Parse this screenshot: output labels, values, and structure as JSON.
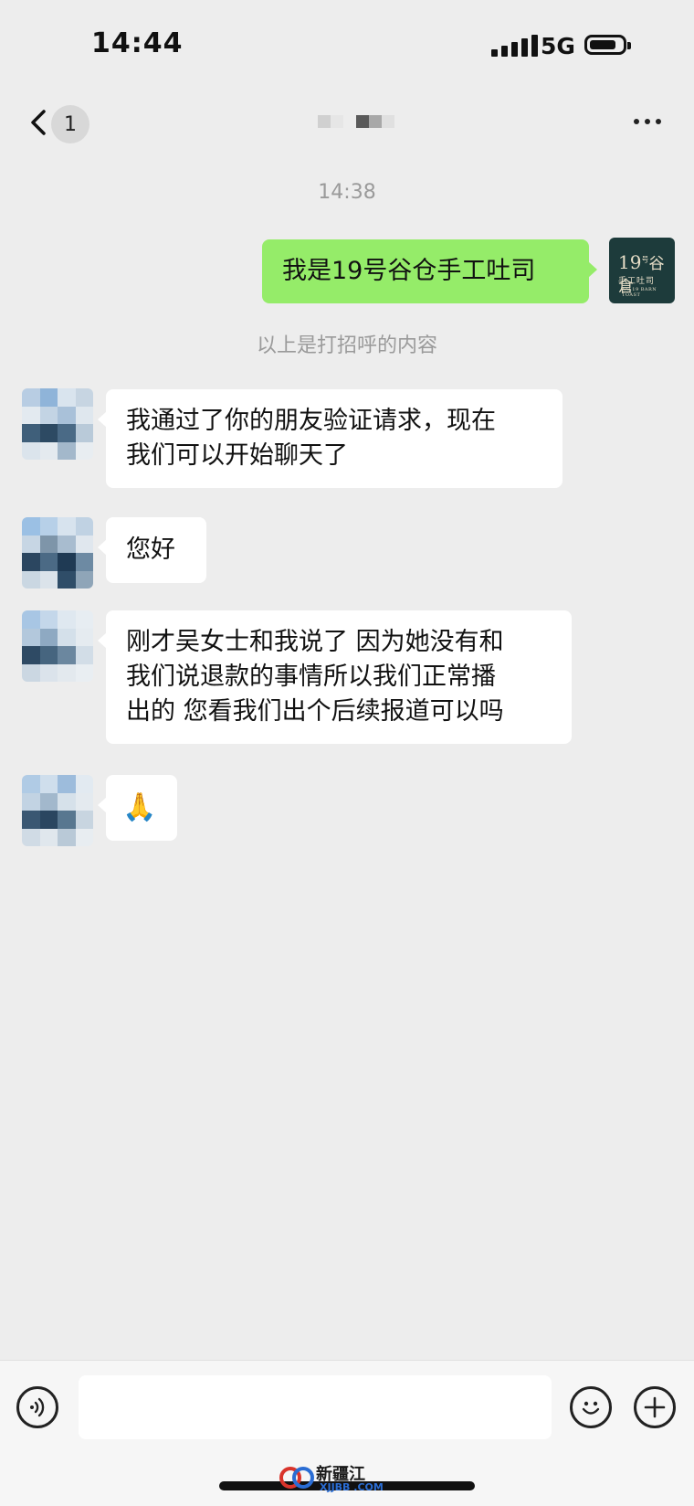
{
  "status_bar": {
    "time": "14:44",
    "network": "5G"
  },
  "nav": {
    "unread_count": "1"
  },
  "chat": {
    "timestamp": "14:38",
    "system_note": "以上是打招呼的内容",
    "messages": [
      {
        "side": "out",
        "text": "我是19号谷仓手工吐司"
      },
      {
        "side": "in",
        "lines": [
          "我通过了你的朋友验证请求，现在",
          "我们可以开始聊天了"
        ]
      },
      {
        "side": "in",
        "text": "您好"
      },
      {
        "side": "in",
        "lines": [
          "刚才吴女士和我说了 因为她没有和",
          "我们说退款的事情所以我们正常播",
          "出的 您看我们出个后续报道可以吗"
        ]
      },
      {
        "side": "in",
        "text": "🙏"
      }
    ]
  },
  "self_avatar": {
    "line1": "19",
    "line1_sup": "号",
    "line2": "谷倉",
    "line3": "手工吐司",
    "line4": "NO.19 BARN TOAST"
  },
  "watermark": {
    "text": "新疆江",
    "sub": "XJJBB .COM"
  },
  "colors": {
    "background": "#ededed",
    "outgoing_bubble": "#95ec69",
    "incoming_bubble": "#ffffff",
    "logo_bg": "#1d3b3b"
  }
}
